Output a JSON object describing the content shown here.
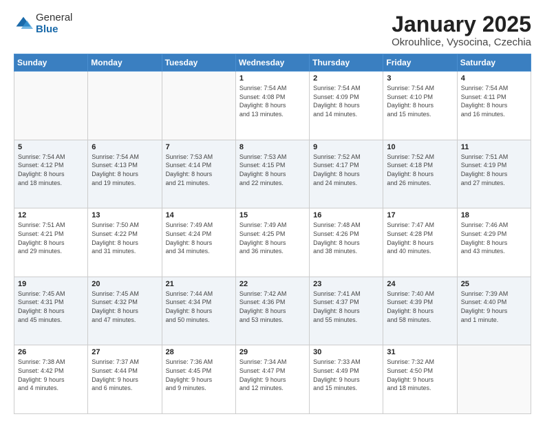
{
  "logo": {
    "general": "General",
    "blue": "Blue"
  },
  "title": {
    "month": "January 2025",
    "location": "Okrouhlice, Vysocina, Czechia"
  },
  "headers": [
    "Sunday",
    "Monday",
    "Tuesday",
    "Wednesday",
    "Thursday",
    "Friday",
    "Saturday"
  ],
  "weeks": [
    [
      {
        "day": "",
        "info": ""
      },
      {
        "day": "",
        "info": ""
      },
      {
        "day": "",
        "info": ""
      },
      {
        "day": "1",
        "info": "Sunrise: 7:54 AM\nSunset: 4:08 PM\nDaylight: 8 hours\nand 13 minutes."
      },
      {
        "day": "2",
        "info": "Sunrise: 7:54 AM\nSunset: 4:09 PM\nDaylight: 8 hours\nand 14 minutes."
      },
      {
        "day": "3",
        "info": "Sunrise: 7:54 AM\nSunset: 4:10 PM\nDaylight: 8 hours\nand 15 minutes."
      },
      {
        "day": "4",
        "info": "Sunrise: 7:54 AM\nSunset: 4:11 PM\nDaylight: 8 hours\nand 16 minutes."
      }
    ],
    [
      {
        "day": "5",
        "info": "Sunrise: 7:54 AM\nSunset: 4:12 PM\nDaylight: 8 hours\nand 18 minutes."
      },
      {
        "day": "6",
        "info": "Sunrise: 7:54 AM\nSunset: 4:13 PM\nDaylight: 8 hours\nand 19 minutes."
      },
      {
        "day": "7",
        "info": "Sunrise: 7:53 AM\nSunset: 4:14 PM\nDaylight: 8 hours\nand 21 minutes."
      },
      {
        "day": "8",
        "info": "Sunrise: 7:53 AM\nSunset: 4:15 PM\nDaylight: 8 hours\nand 22 minutes."
      },
      {
        "day": "9",
        "info": "Sunrise: 7:52 AM\nSunset: 4:17 PM\nDaylight: 8 hours\nand 24 minutes."
      },
      {
        "day": "10",
        "info": "Sunrise: 7:52 AM\nSunset: 4:18 PM\nDaylight: 8 hours\nand 26 minutes."
      },
      {
        "day": "11",
        "info": "Sunrise: 7:51 AM\nSunset: 4:19 PM\nDaylight: 8 hours\nand 27 minutes."
      }
    ],
    [
      {
        "day": "12",
        "info": "Sunrise: 7:51 AM\nSunset: 4:21 PM\nDaylight: 8 hours\nand 29 minutes."
      },
      {
        "day": "13",
        "info": "Sunrise: 7:50 AM\nSunset: 4:22 PM\nDaylight: 8 hours\nand 31 minutes."
      },
      {
        "day": "14",
        "info": "Sunrise: 7:49 AM\nSunset: 4:24 PM\nDaylight: 8 hours\nand 34 minutes."
      },
      {
        "day": "15",
        "info": "Sunrise: 7:49 AM\nSunset: 4:25 PM\nDaylight: 8 hours\nand 36 minutes."
      },
      {
        "day": "16",
        "info": "Sunrise: 7:48 AM\nSunset: 4:26 PM\nDaylight: 8 hours\nand 38 minutes."
      },
      {
        "day": "17",
        "info": "Sunrise: 7:47 AM\nSunset: 4:28 PM\nDaylight: 8 hours\nand 40 minutes."
      },
      {
        "day": "18",
        "info": "Sunrise: 7:46 AM\nSunset: 4:29 PM\nDaylight: 8 hours\nand 43 minutes."
      }
    ],
    [
      {
        "day": "19",
        "info": "Sunrise: 7:45 AM\nSunset: 4:31 PM\nDaylight: 8 hours\nand 45 minutes."
      },
      {
        "day": "20",
        "info": "Sunrise: 7:45 AM\nSunset: 4:32 PM\nDaylight: 8 hours\nand 47 minutes."
      },
      {
        "day": "21",
        "info": "Sunrise: 7:44 AM\nSunset: 4:34 PM\nDaylight: 8 hours\nand 50 minutes."
      },
      {
        "day": "22",
        "info": "Sunrise: 7:42 AM\nSunset: 4:36 PM\nDaylight: 8 hours\nand 53 minutes."
      },
      {
        "day": "23",
        "info": "Sunrise: 7:41 AM\nSunset: 4:37 PM\nDaylight: 8 hours\nand 55 minutes."
      },
      {
        "day": "24",
        "info": "Sunrise: 7:40 AM\nSunset: 4:39 PM\nDaylight: 8 hours\nand 58 minutes."
      },
      {
        "day": "25",
        "info": "Sunrise: 7:39 AM\nSunset: 4:40 PM\nDaylight: 9 hours\nand 1 minute."
      }
    ],
    [
      {
        "day": "26",
        "info": "Sunrise: 7:38 AM\nSunset: 4:42 PM\nDaylight: 9 hours\nand 4 minutes."
      },
      {
        "day": "27",
        "info": "Sunrise: 7:37 AM\nSunset: 4:44 PM\nDaylight: 9 hours\nand 6 minutes."
      },
      {
        "day": "28",
        "info": "Sunrise: 7:36 AM\nSunset: 4:45 PM\nDaylight: 9 hours\nand 9 minutes."
      },
      {
        "day": "29",
        "info": "Sunrise: 7:34 AM\nSunset: 4:47 PM\nDaylight: 9 hours\nand 12 minutes."
      },
      {
        "day": "30",
        "info": "Sunrise: 7:33 AM\nSunset: 4:49 PM\nDaylight: 9 hours\nand 15 minutes."
      },
      {
        "day": "31",
        "info": "Sunrise: 7:32 AM\nSunset: 4:50 PM\nDaylight: 9 hours\nand 18 minutes."
      },
      {
        "day": "",
        "info": ""
      }
    ]
  ]
}
